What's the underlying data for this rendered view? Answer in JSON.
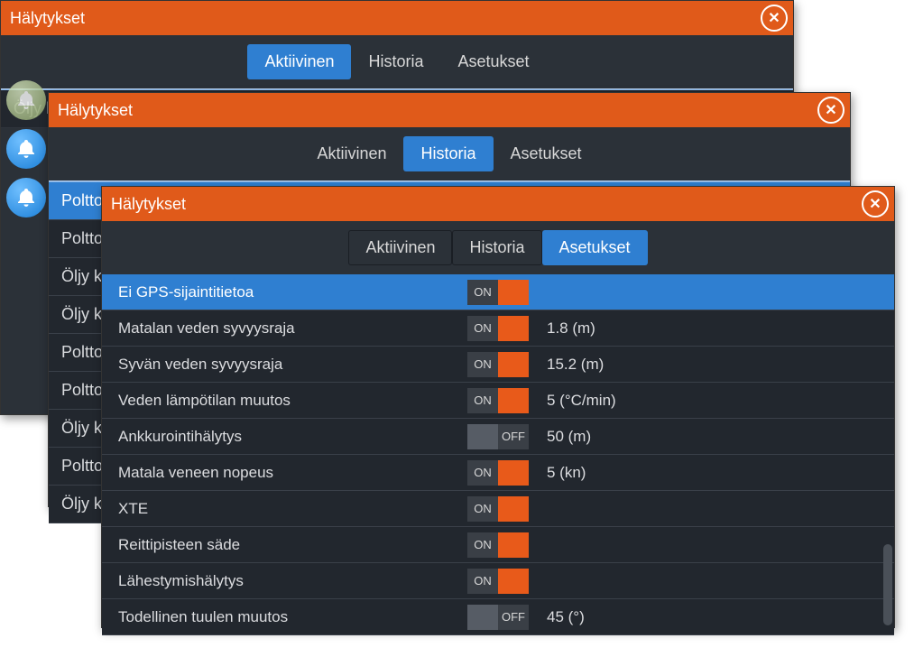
{
  "title": "Hälytykset",
  "tabs": {
    "active": "Aktiivinen",
    "history": "Historia",
    "settings": "Asetukset"
  },
  "win1": {
    "rows": [
      "Öljy korkea"
    ]
  },
  "win2": {
    "rows": [
      "Poltto",
      "Poltto",
      "Öljy k",
      "Öljy k",
      "Poltto",
      "Poltto",
      "Öljy k",
      "Poltto",
      "Öljy k"
    ],
    "selected_index": 0
  },
  "win3": {
    "items": [
      {
        "label": "Ei GPS-sijaintitietoa",
        "state": "ON",
        "value": "",
        "selected": true
      },
      {
        "label": "Matalan veden syvyysraja",
        "state": "ON",
        "value": "1.8 (m)"
      },
      {
        "label": "Syvän veden syvyysraja",
        "state": "ON",
        "value": "15.2 (m)"
      },
      {
        "label": "Veden lämpötilan muutos",
        "state": "ON",
        "value": "5 (°C/min)"
      },
      {
        "label": "Ankkurointihälytys",
        "state": "OFF",
        "value": "50 (m)"
      },
      {
        "label": "Matala veneen nopeus",
        "state": "ON",
        "value": "5 (kn)"
      },
      {
        "label": "XTE",
        "state": "ON",
        "value": ""
      },
      {
        "label": "Reittipisteen säde",
        "state": "ON",
        "value": ""
      },
      {
        "label": "Lähestymishälytys",
        "state": "ON",
        "value": ""
      },
      {
        "label": "Todellinen tuulen muutos",
        "state": "OFF",
        "value": "45 (°)"
      }
    ]
  }
}
